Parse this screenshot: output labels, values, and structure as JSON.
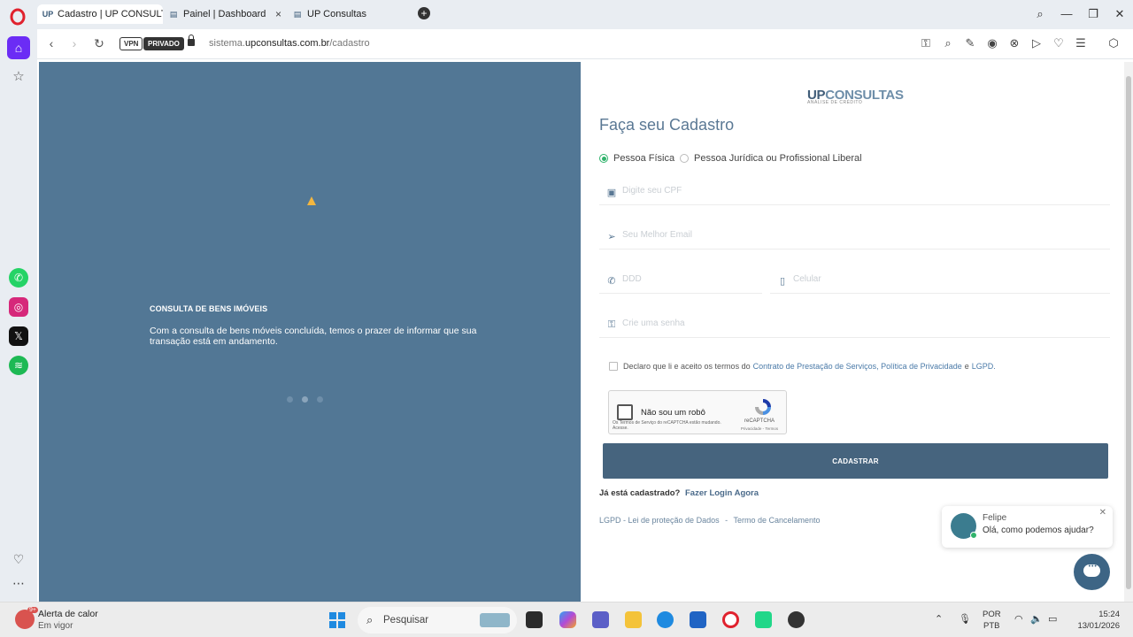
{
  "browser": {
    "tabs": [
      {
        "favicon": "UP",
        "title": "Cadastro | UP CONSULTAS",
        "active": true
      },
      {
        "favicon": "page-icon",
        "title": "Painel | Dashboard Co",
        "active": false
      },
      {
        "favicon": "page-icon",
        "title": "UP Consultas",
        "active": false
      }
    ],
    "vpn_label": "VPN",
    "private_label": "PRIVADO",
    "url_domain_prefix": "sistema.",
    "url_domain": "upconsultas.com.br",
    "url_path": "/cadastro"
  },
  "left_panel": {
    "title": "CONSULTA DE BENS IMÓVEIS",
    "text": "Com a consulta de bens móveis concluída, temos o prazer de informar que sua transação está em andamento.",
    "background": "#527795"
  },
  "form": {
    "brand_up": "UP",
    "brand_rest": "CONSULTAS",
    "brand_sub": "ANÁLISE DE CRÉDITO",
    "title": "Faça seu Cadastro",
    "radio_pf": "Pessoa Física",
    "radio_pj": "Pessoa Jurídica ou Profissional Liberal",
    "cpf_placeholder": "Digite seu CPF",
    "email_placeholder": "Seu Melhor Email",
    "ddd_placeholder": "DDD",
    "phone_placeholder": "Celular",
    "password_placeholder": "Crie uma senha",
    "terms_prefix": "Declaro que li e aceito os termos do",
    "terms_link1": "Contrato de Prestação de Serviços, Política de Privacidade",
    "terms_and": "e",
    "terms_link2": "LGPD.",
    "recaptcha_label": "Não sou um robô",
    "recaptcha_small": "Os Termos de Serviço do reCAPTCHA estão mudando. Acesse.",
    "recaptcha_brand": "reCAPTCHA",
    "recaptcha_privacy": "Privacidade - Termos",
    "submit_label": "CADASTRAR",
    "already_text": "Já está cadastrado?",
    "login_link": "Fazer Login Agora",
    "footer_lgpd": "LGPD - Lei de proteção de Dados",
    "footer_sep": "-",
    "footer_cancel": "Termo de Cancelamento",
    "primary_color": "#46647e"
  },
  "chat": {
    "name": "Felipe",
    "message": "Olá, como podemos ajudar?"
  },
  "taskbar": {
    "weather_title": "Alerta de calor",
    "weather_sub": "Em vigor",
    "weather_badge": "9+",
    "search_placeholder": "Pesquisar",
    "lang_1": "POR",
    "lang_2": "PTB",
    "time": "15:24",
    "date": "13/01/2026"
  }
}
